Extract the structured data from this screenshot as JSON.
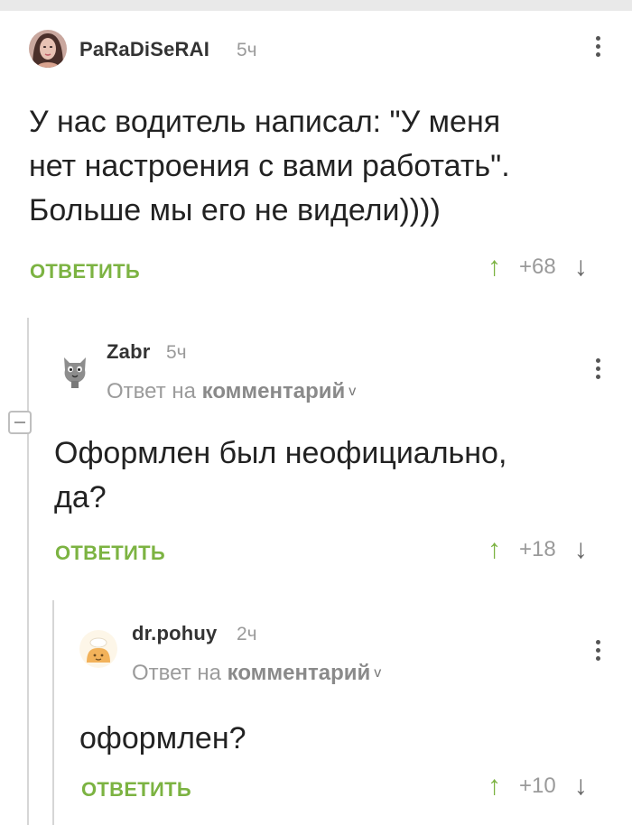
{
  "comments": [
    {
      "author": "PaRaDiSeRAI",
      "time": "5ч",
      "lines": [
        "У нас водитель написал: \"У меня",
        "нет настроения с вами работать\".",
        "Больше мы его не видели))))"
      ],
      "reply_label": "ОТВЕТИТЬ",
      "rating": "+68"
    },
    {
      "author": "Zabr",
      "time": "5ч",
      "reply_to_prefix": "Ответ на",
      "reply_to_link": "комментарий",
      "lines": [
        "Оформлен был неофициально,",
        "да?"
      ],
      "reply_label": "ОТВЕТИТЬ",
      "rating": "+18"
    },
    {
      "author": "dr.pohuy",
      "time": "2ч",
      "reply_to_prefix": "Ответ на",
      "reply_to_link": "комментарий",
      "lines": [
        "оформлен?"
      ],
      "reply_label": "ОТВЕТИТЬ",
      "rating": "+10"
    }
  ],
  "icons": {
    "upvote": "arrow-up-icon",
    "downvote": "arrow-down-icon",
    "menu": "kebab-menu-icon",
    "collapse": "minus-icon",
    "chevron": "chevron-down-icon"
  },
  "colors": {
    "accent_green": "#7cb342",
    "text": "#222222",
    "muted": "#9a9a9a",
    "thread_line": "#d6d6d6"
  }
}
